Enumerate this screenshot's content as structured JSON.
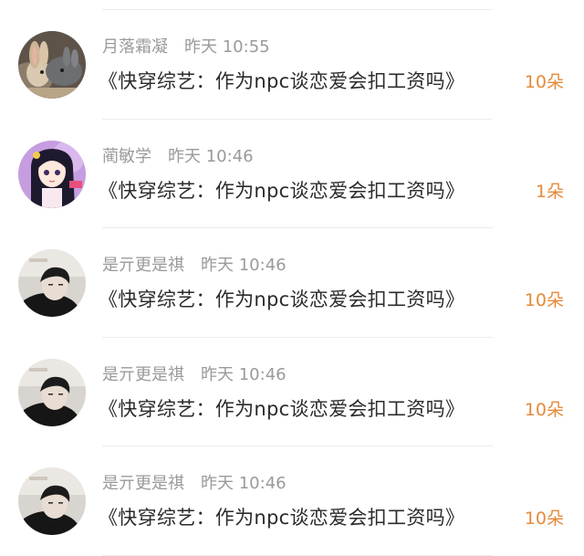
{
  "comments": [
    {
      "user": "月落霜凝",
      "time": "昨天 10:55",
      "text": "《快穿综艺：作为npc谈恋爱会扣工资吗》",
      "count": "10朵",
      "avatar_icon": "rabbit-avatar-icon"
    },
    {
      "user": "蔺敏学",
      "time": "昨天 10:46",
      "text": "《快穿综艺：作为npc谈恋爱会扣工资吗》",
      "count": "1朵",
      "avatar_icon": "anime-girl-avatar-icon"
    },
    {
      "user": "是亓更是祺",
      "time": "昨天 10:46",
      "text": "《快穿综艺：作为npc谈恋爱会扣工资吗》",
      "count": "10朵",
      "avatar_icon": "person-avatar-icon"
    },
    {
      "user": "是亓更是祺",
      "time": "昨天 10:46",
      "text": "《快穿综艺：作为npc谈恋爱会扣工资吗》",
      "count": "10朵",
      "avatar_icon": "person-avatar-icon"
    },
    {
      "user": "是亓更是祺",
      "time": "昨天 10:46",
      "text": "《快穿综艺：作为npc谈恋爱会扣工资吗》",
      "count": "10朵",
      "avatar_icon": "person-avatar-icon"
    }
  ],
  "colors": {
    "meta": "#9a9a9a",
    "title": "#2b2b2b",
    "count": "#e58a3a"
  }
}
